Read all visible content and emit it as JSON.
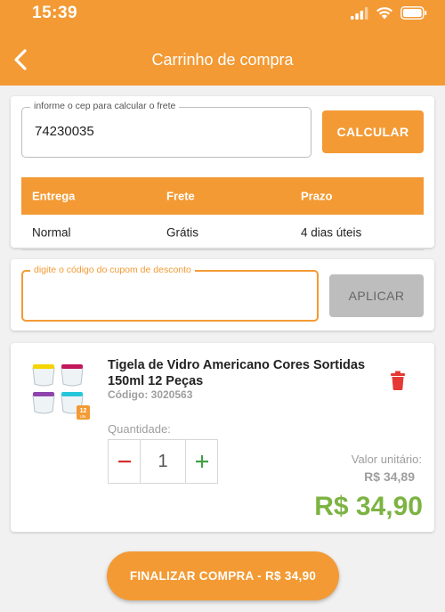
{
  "status_bar": {
    "time": "15:39"
  },
  "header": {
    "title": "Carrinho de compra",
    "back_icon": "chevron-left-icon"
  },
  "shipping": {
    "cep_label": "informe o cep para calcular o frete",
    "cep_value": "74230035",
    "calculate_label": "CALCULAR",
    "table": {
      "headers": [
        "Entrega",
        "Frete",
        "Prazo"
      ],
      "rows": [
        [
          "Normal",
          "Grátis",
          "4 dias úteis"
        ]
      ]
    }
  },
  "coupon": {
    "label": "digite o código do cupom de desconto",
    "value": "",
    "apply_label": "APLICAR"
  },
  "cart_item": {
    "name": "Tigela de Vidro Americano Cores Sortidas 150ml 12 Peças",
    "code": "Código: 3020563",
    "quantity_label": "Quantidade:",
    "quantity": "1",
    "unit_price_label": "Valor unitário:",
    "unit_price": "R$ 34,89",
    "total_price": "R$ 34,90",
    "image_badge": "12",
    "image_badge_sub": "UN."
  },
  "checkout": {
    "label": "FINALIZAR COMPRA - R$ 34,90"
  },
  "colors": {
    "primary": "#f39a34",
    "price_green": "#7cb342",
    "trash_red": "#e53935",
    "disabled_grey": "#bdbdbd"
  }
}
